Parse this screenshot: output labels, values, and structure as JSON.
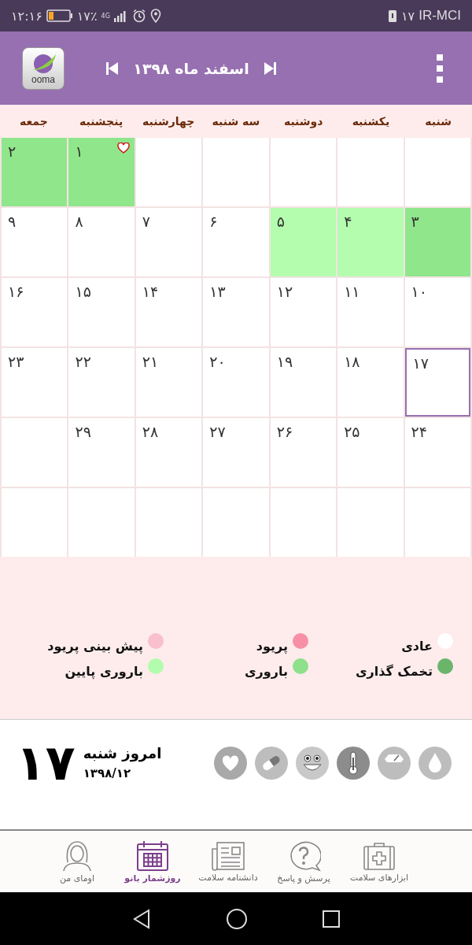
{
  "status_bar": {
    "time": "۱۲:۱۶",
    "battery": "۱۷٪",
    "network": "4G",
    "carrier": "IR-MCI",
    "carrier_number": "۱۷"
  },
  "header": {
    "title": "اسفند ماه ۱۳۹۸",
    "logo_text": "ooma"
  },
  "weekdays": [
    "شنبه",
    "یکشنبه",
    "دوشنبه",
    "سه شنبه",
    "چهارشنبه",
    "پنجشنبه",
    "جمعه"
  ],
  "days": [
    {
      "kind": "blank"
    },
    {
      "kind": "blank"
    },
    {
      "kind": "blank"
    },
    {
      "kind": "blank"
    },
    {
      "kind": "blank"
    },
    {
      "kind": "day",
      "label": "۱",
      "color": "#90e68a",
      "marked": true,
      "today": false
    },
    {
      "kind": "day",
      "label": "۲",
      "color": "#90e68a",
      "marked": false,
      "today": false
    },
    {
      "kind": "day",
      "label": "۳",
      "color": "#90e68a",
      "marked": false,
      "today": false
    },
    {
      "kind": "day",
      "label": "۴",
      "color": "#b4fcae",
      "marked": false,
      "today": false
    },
    {
      "kind": "day",
      "label": "۵",
      "color": "#b4fcae",
      "marked": false,
      "today": false
    },
    {
      "kind": "day",
      "label": "۶",
      "color": "#ffffff",
      "marked": false,
      "today": false
    },
    {
      "kind": "day",
      "label": "۷",
      "color": "#ffffff",
      "marked": false,
      "today": false
    },
    {
      "kind": "day",
      "label": "۸",
      "color": "#ffffff",
      "marked": false,
      "today": false
    },
    {
      "kind": "day",
      "label": "۹",
      "color": "#ffffff",
      "marked": false,
      "today": false
    },
    {
      "kind": "day",
      "label": "۱۰",
      "color": "#ffffff",
      "marked": false,
      "today": false
    },
    {
      "kind": "day",
      "label": "۱۱",
      "color": "#ffffff",
      "marked": false,
      "today": false
    },
    {
      "kind": "day",
      "label": "۱۲",
      "color": "#ffffff",
      "marked": false,
      "today": false
    },
    {
      "kind": "day",
      "label": "۱۳",
      "color": "#ffffff",
      "marked": false,
      "today": false
    },
    {
      "kind": "day",
      "label": "۱۴",
      "color": "#ffffff",
      "marked": false,
      "today": false
    },
    {
      "kind": "day",
      "label": "۱۵",
      "color": "#ffffff",
      "marked": false,
      "today": false
    },
    {
      "kind": "day",
      "label": "۱۶",
      "color": "#ffffff",
      "marked": false,
      "today": false
    },
    {
      "kind": "day",
      "label": "۱۷",
      "color": "#ffffff",
      "marked": false,
      "today": true
    },
    {
      "kind": "day",
      "label": "۱۸",
      "color": "#ffffff",
      "marked": false,
      "today": false
    },
    {
      "kind": "day",
      "label": "۱۹",
      "color": "#ffffff",
      "marked": false,
      "today": false
    },
    {
      "kind": "day",
      "label": "۲۰",
      "color": "#ffffff",
      "marked": false,
      "today": false
    },
    {
      "kind": "day",
      "label": "۲۱",
      "color": "#ffffff",
      "marked": false,
      "today": false
    },
    {
      "kind": "day",
      "label": "۲۲",
      "color": "#ffffff",
      "marked": false,
      "today": false
    },
    {
      "kind": "day",
      "label": "۲۳",
      "color": "#ffffff",
      "marked": false,
      "today": false
    },
    {
      "kind": "day",
      "label": "۲۴",
      "color": "#ffffff",
      "marked": false,
      "today": false
    },
    {
      "kind": "day",
      "label": "۲۵",
      "color": "#ffffff",
      "marked": false,
      "today": false
    },
    {
      "kind": "day",
      "label": "۲۶",
      "color": "#ffffff",
      "marked": false,
      "today": false
    },
    {
      "kind": "day",
      "label": "۲۷",
      "color": "#ffffff",
      "marked": false,
      "today": false
    },
    {
      "kind": "day",
      "label": "۲۸",
      "color": "#ffffff",
      "marked": false,
      "today": false
    },
    {
      "kind": "day",
      "label": "۲۹",
      "color": "#ffffff",
      "marked": false,
      "today": false
    },
    {
      "kind": "blank"
    },
    {
      "kind": "blank"
    },
    {
      "kind": "blank"
    },
    {
      "kind": "blank"
    },
    {
      "kind": "blank"
    },
    {
      "kind": "blank"
    },
    {
      "kind": "blank"
    },
    {
      "kind": "blank"
    }
  ],
  "legend": [
    {
      "label": "عادی",
      "color": "#ffffff"
    },
    {
      "label": "پریود",
      "color": "#f78fa7"
    },
    {
      "label": "پیش بینی پریود",
      "color": "#f9c0cb"
    },
    {
      "label": "تخمک گذاری",
      "color": "#6bb56b"
    },
    {
      "label": "باروری",
      "color": "#8ee08a"
    },
    {
      "label": "باروری پایین",
      "color": "#b3fcae"
    }
  ],
  "today": {
    "day": "۱۷",
    "title": "امروز شنبه",
    "date": "۱۳۹۸/۱۲"
  },
  "tools": [
    {
      "kind": "heart"
    },
    {
      "kind": "pill"
    },
    {
      "kind": "smiley"
    },
    {
      "kind": "thermometer"
    },
    {
      "kind": "scale"
    },
    {
      "kind": "drop"
    }
  ],
  "nav": [
    {
      "label": "ابزارهای سلامت",
      "kind": "kit",
      "selected": false
    },
    {
      "label": "پرسش و پاسخ",
      "kind": "question",
      "selected": false
    },
    {
      "label": "دانشنامه سلامت",
      "kind": "news",
      "selected": false
    },
    {
      "label": "روزشمار بانو",
      "kind": "calendar",
      "selected": true
    },
    {
      "label": "اومای من",
      "kind": "person",
      "selected": false
    }
  ]
}
